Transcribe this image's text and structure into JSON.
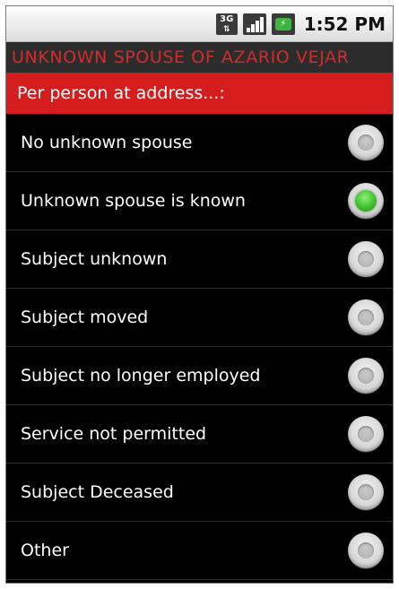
{
  "status_bar": {
    "time": "1:52 PM",
    "network_label": "3G",
    "network_arrows": "⇅",
    "icons": [
      "3g-data-icon",
      "signal-strength-icon",
      "battery-charging-icon"
    ]
  },
  "title_bar": {
    "title": "UNKNOWN SPOUSE OF AZARIO VEJAR"
  },
  "header": {
    "text": "Per person at address...:"
  },
  "colors": {
    "title_text": "#d42a2a",
    "header_band": "#d61d1d",
    "selected_radio": "#3fbf2e",
    "background": "#000000"
  },
  "options": [
    {
      "label": "No unknown spouse",
      "checked": false
    },
    {
      "label": "Unknown spouse is known",
      "checked": true
    },
    {
      "label": "Subject unknown",
      "checked": false
    },
    {
      "label": "Subject moved",
      "checked": false
    },
    {
      "label": "Subject no longer employed",
      "checked": false
    },
    {
      "label": "Service not permitted",
      "checked": false
    },
    {
      "label": "Subject Deceased",
      "checked": false
    },
    {
      "label": "Other",
      "checked": false
    }
  ]
}
